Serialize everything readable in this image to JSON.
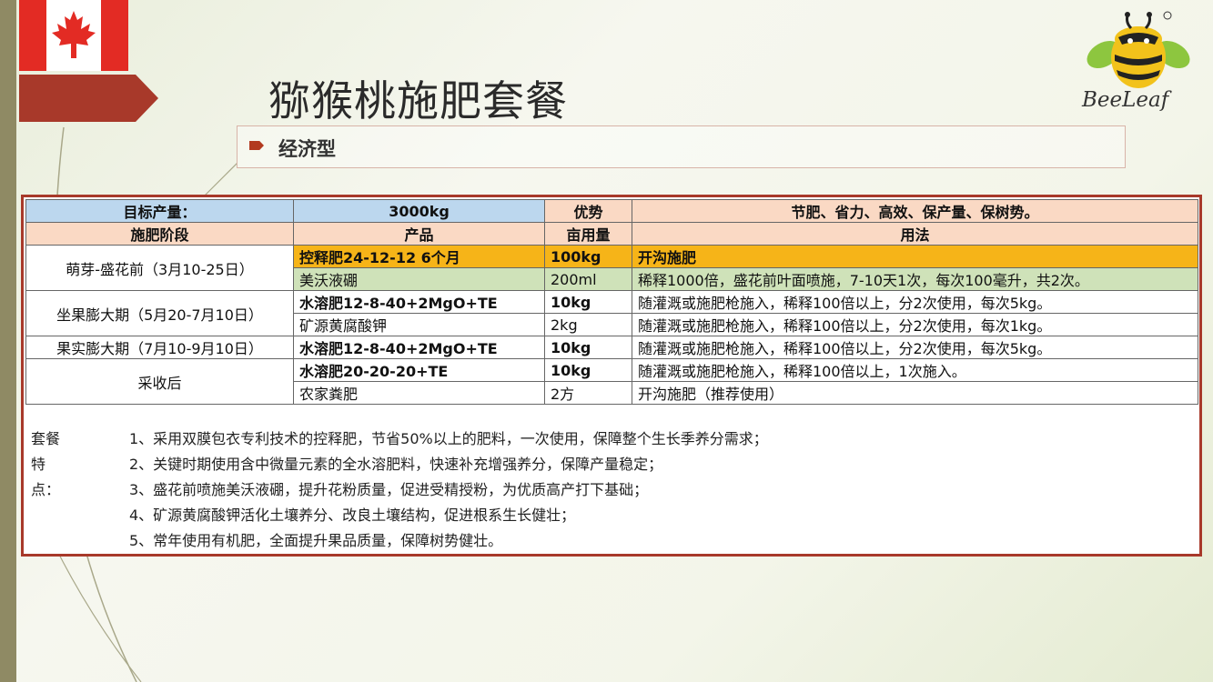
{
  "title": "猕猴桃施肥套餐",
  "subtitle": "经济型",
  "logo_text": "BeeLeaf",
  "colors": {
    "accent": "#a8392a",
    "header_blue": "#bcd7ee",
    "header_peach": "#fad9c4",
    "highlight_orange": "#f6b418",
    "highlight_green": "#cfe2b9"
  },
  "table": {
    "header1": {
      "target_label": "目标产量：",
      "target_value": "3000kg",
      "advantage_label": "优势",
      "advantage_value": "节肥、省力、高效、保产量、保树势。"
    },
    "header2": {
      "stage": "施肥阶段",
      "product": "产品",
      "amount": "亩用量",
      "usage": "用法"
    },
    "rows": [
      {
        "stage": "萌芽-盛花前（3月10-25日）",
        "product": "控释肥24-12-12 6个月",
        "amount": "100kg",
        "usage": "开沟施肥"
      },
      {
        "product": "美沃液硼",
        "amount": "200ml",
        "usage": "稀释1000倍，盛花前叶面喷施，7-10天1次，每次100毫升，共2次。"
      },
      {
        "stage": "坐果膨大期（5月20-7月10日）",
        "product": "水溶肥12-8-40+2MgO+TE",
        "amount": "10kg",
        "usage": "随灌溉或施肥枪施入，稀释100倍以上，分2次使用，每次5kg。"
      },
      {
        "product": "矿源黄腐酸钾",
        "amount": "2kg",
        "usage": "随灌溉或施肥枪施入，稀释100倍以上，分2次使用，每次1kg。"
      },
      {
        "stage": "果实膨大期（7月10-9月10日）",
        "product": "水溶肥12-8-40+2MgO+TE",
        "amount": "10kg",
        "usage": "随灌溉或施肥枪施入，稀释100倍以上，分2次使用，每次5kg。"
      },
      {
        "stage": "采收后",
        "product": "水溶肥20-20-20+TE",
        "amount": "10kg",
        "usage": "随灌溉或施肥枪施入，稀释100倍以上，1次施入。"
      },
      {
        "product": "农家粪肥",
        "amount": "2方",
        "usage": "开沟施肥（推荐使用）"
      }
    ]
  },
  "features": {
    "label": "套餐特点：",
    "items": [
      "1、采用双膜包衣专利技术的控释肥，节省50%以上的肥料，一次使用，保障整个生长季养分需求；",
      "2、关键时期使用含中微量元素的全水溶肥料，快速补充增强养分，保障产量稳定；",
      "3、盛花前喷施美沃液硼，提升花粉质量，促进受精授粉，为优质高产打下基础；",
      "4、矿源黄腐酸钾活化土壤养分、改良土壤结构，促进根系生长健壮；",
      "5、常年使用有机肥，全面提升果品质量，保障树势健壮。"
    ]
  }
}
